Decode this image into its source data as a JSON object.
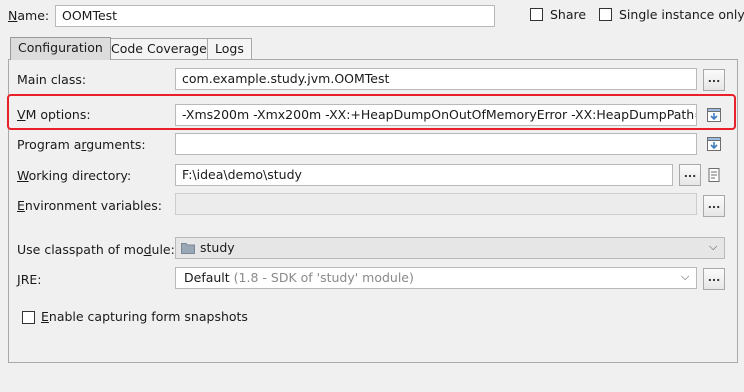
{
  "header": {
    "name_label_prefix": "N",
    "name_label_rest": "ame:",
    "name_value": "OOMTest",
    "share_label": "Share",
    "single_instance_label": "Single instance only"
  },
  "tabs": [
    {
      "label": "Configuration",
      "active": true
    },
    {
      "label": "Code Coverage",
      "active": false
    },
    {
      "label": "Logs",
      "active": false
    }
  ],
  "config": {
    "main_class": {
      "label": "Main class:",
      "value": "com.example.study.jvm.OOMTest",
      "button": "..."
    },
    "vm_options": {
      "label_u": "V",
      "label_rest": "M options:",
      "value": "-Xms200m -Xmx200m -XX:+HeapDumpOnOutOfMemoryError -XX:HeapDumpPath=./"
    },
    "program_arguments": {
      "label_pre": "Program a",
      "label_u": "r",
      "label_rest": "guments:",
      "value": ""
    },
    "working_directory": {
      "label_u": "W",
      "label_rest": "orking directory:",
      "value": "F:\\idea\\demo\\study",
      "button": "..."
    },
    "environment_variables": {
      "label_u": "E",
      "label_rest": "nvironment variables:",
      "value": "",
      "button": "..."
    },
    "classpath_module": {
      "label_pre": "Use classpath of mo",
      "label_u": "d",
      "label_rest": "ule:",
      "value": "study"
    },
    "jre": {
      "label_u": "J",
      "label_rest": "RE:",
      "value_main": "Default",
      "value_muted": "(1.8 - SDK of 'study' module)",
      "button": "..."
    },
    "form_snapshots": {
      "label_u": "E",
      "label_rest": "nable capturing form snapshots"
    }
  },
  "colors": {
    "highlight": "#e8202a",
    "accent_blue": "#3f7fbf"
  }
}
